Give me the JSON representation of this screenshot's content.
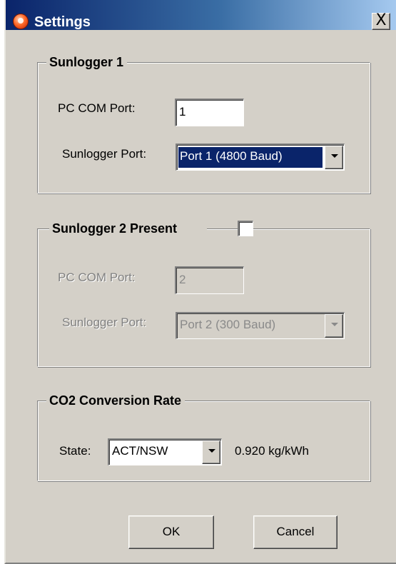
{
  "window": {
    "title": "Settings",
    "close_symbol": "X"
  },
  "icons": {
    "app": "app-logo-icon",
    "close": "close-icon",
    "dropdown": "chevron-down-icon"
  },
  "colors": {
    "titlebar_start": "#0a246a",
    "titlebar_end": "#a6caf0",
    "dialog_bg": "#d4d0c8",
    "selection_bg": "#0a246a",
    "disabled_text": "#808080"
  },
  "sunlogger1": {
    "legend": "Sunlogger 1",
    "pc_com_port_label": "PC COM Port:",
    "pc_com_port_value": "1",
    "sunlogger_port_label": "Sunlogger Port:",
    "sunlogger_port_value": "Port 1 (4800 Baud)"
  },
  "sunlogger2": {
    "legend": "Sunlogger 2 Present",
    "present_checked": false,
    "pc_com_port_label": "PC COM Port:",
    "pc_com_port_value": "2",
    "sunlogger_port_label": "Sunlogger Port:",
    "sunlogger_port_value": "Port 2 (300 Baud)",
    "enabled": false
  },
  "co2": {
    "legend": "CO2 Conversion Rate",
    "state_label": "State:",
    "state_value": "ACT/NSW",
    "rate_text": "0.920 kg/kWh"
  },
  "buttons": {
    "ok_label": "OK",
    "cancel_label": "Cancel"
  }
}
